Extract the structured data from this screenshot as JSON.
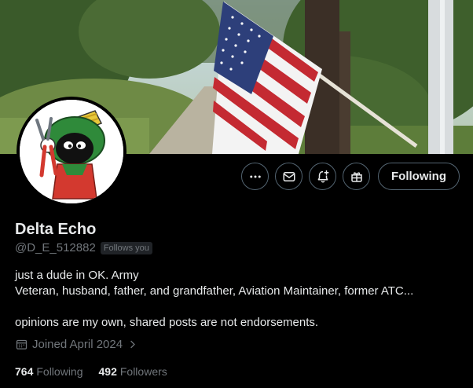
{
  "profile": {
    "name": "Delta Echo",
    "handle": "@D_E_512882",
    "follows_you": "Follows you",
    "bio_line1": "just a dude in OK. Army",
    "bio_line2": "Veteran, husband, father, and grandfather, Aviation Maintainer, former ATC...",
    "bio_line3": "opinions are my own, shared posts are not endorsements.",
    "joined": "Joined April 2024",
    "following_count": "764",
    "following_label": "Following",
    "followers_count": "492",
    "followers_label": "Followers"
  },
  "actions": {
    "more_icon": "more-icon",
    "message_icon": "mail-icon",
    "notify_icon": "bell-plus-icon",
    "gift_icon": "gift-icon",
    "follow_label": "Following"
  },
  "colors": {
    "background": "#000000",
    "text_primary": "#e7e9ea",
    "text_secondary": "#71767b",
    "border": "#536471"
  }
}
